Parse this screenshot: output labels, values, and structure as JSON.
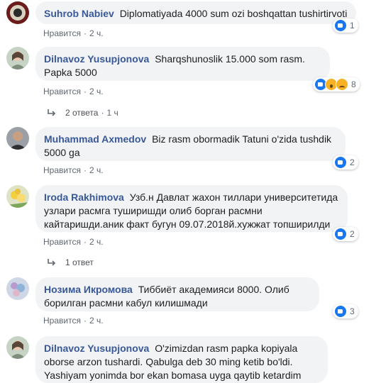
{
  "like_label": "Нравится",
  "comments": [
    {
      "author": "Suhrob Nabiev",
      "text": "Diplomatiyada 4000 sum ozi boshqattan tushirtirvoti",
      "time": "2 ч.",
      "reactions": [
        "like"
      ],
      "reaction_count": "1"
    },
    {
      "author": "Dilnavoz Yusupjonova",
      "text": "Sharqshunoslik 15.000 som rasm. Papka 5000",
      "time": "2 ч.",
      "reactions": [
        "like",
        "wow",
        "sad"
      ],
      "reaction_count": "8",
      "replies": "2 ответа",
      "replies_time": "1 ч"
    },
    {
      "author": "Muhammad Axmedov",
      "text": "Biz rasm obormadik Tatuni o'zida tushdik 5000 ga",
      "time": "2 ч.",
      "reactions": [
        "like"
      ],
      "reaction_count": "2"
    },
    {
      "author": "Iroda Rakhimova",
      "text": "Узб.н Давлат жахон тиллари университетида узлари расмга туширишди олиб борган расмни кайтаришди.аник факт бугун 09.07.2018й.хужжат топширилди",
      "time": "2 ч.",
      "reactions": [
        "like"
      ],
      "reaction_count": "2",
      "replies": "1 ответ"
    },
    {
      "author": "Нозима Икромова",
      "text": "Тиббиёт академияси 8000. Олиб борилган расмни кабул килишмади",
      "time": "2 ч.",
      "reactions": [
        "like"
      ],
      "reaction_count": "3"
    },
    {
      "author": "Dilnavoz Yusupjonova",
      "text": "O'zimizdan rasm papka kopiyala oborse arzon tushardi. Qabulga deb 30 ming ketib bo'ldi. Yashiyam yonimda bor ekan bomasa uyga qaytib ketardim",
      "time": "",
      "reactions": [],
      "reaction_count": ""
    }
  ]
}
